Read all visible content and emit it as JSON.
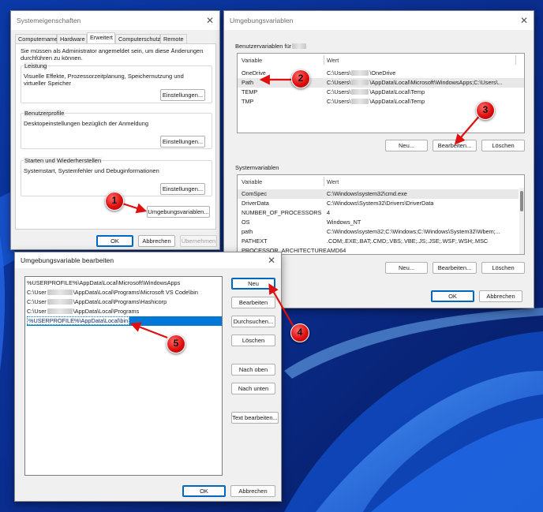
{
  "sysprops": {
    "title": "Systemeigenschaften",
    "tabs": [
      "Computername",
      "Hardware",
      "Erweitert",
      "Computerschutz",
      "Remote"
    ],
    "admin_note": "Sie müssen als Administrator angemeldet sein, um diese Änderungen durchführen zu können.",
    "perf_label": "Leistung",
    "perf_desc": "Visuelle Effekte, Prozessorzeitplanung, Speichernutzung und virtueller Speicher",
    "profiles_label": "Benutzerprofile",
    "profiles_desc": "Desktopeinstellungen bezüglich der Anmeldung",
    "startup_label": "Starten und Wiederherstellen",
    "startup_desc": "Systemstart, Systemfehler und Debuginformationen",
    "settings_btn": "Einstellungen...",
    "envvars_btn": "Umgebungsvariablen...",
    "ok": "OK",
    "cancel": "Abbrechen",
    "apply": "Übernehmen"
  },
  "envvars": {
    "title": "Umgebungsvariablen",
    "user_group_label": "Benutzervariablen für",
    "col_variable": "Variable",
    "col_value": "Wert",
    "user_vars": [
      {
        "name": "OneDrive",
        "pre": "C:\\Users\\",
        "post": "\\OneDrive"
      },
      {
        "name": "Path",
        "pre": "C:\\Users\\",
        "post": "\\AppData\\Local\\Microsoft\\WindowsApps;C:\\Users\\..."
      },
      {
        "name": "TEMP",
        "pre": "C:\\Users\\",
        "post": "\\AppData\\Local\\Temp"
      },
      {
        "name": "TMP",
        "pre": "C:\\Users\\",
        "post": "\\AppData\\Local\\Temp"
      }
    ],
    "system_group_label": "Systemvariablen",
    "system_vars": [
      {
        "name": "ComSpec",
        "value": "C:\\Windows\\system32\\cmd.exe"
      },
      {
        "name": "DriverData",
        "value": "C:\\Windows\\System32\\Drivers\\DriverData"
      },
      {
        "name": "NUMBER_OF_PROCESSORS",
        "value": "4"
      },
      {
        "name": "OS",
        "value": "Windows_NT"
      },
      {
        "name": "path",
        "value": "C:\\Windows\\system32;C:\\Windows;C:\\Windows\\System32\\Wbem;..."
      },
      {
        "name": "PATHEXT",
        "value": ".COM;.EXE;.BAT;.CMD;.VBS;.VBE;.JS;.JSE;.WSF;.WSH;.MSC"
      },
      {
        "name": "PROCESSOR_ARCHITECTURE",
        "value": "AMD64"
      }
    ],
    "new_btn": "Neu...",
    "edit_btn": "Bearbeiten...",
    "delete_btn": "Löschen",
    "ok": "OK",
    "cancel": "Abbrechen"
  },
  "editdlg": {
    "title": "Umgebungsvariable bearbeiten",
    "entries": [
      {
        "pre": "%USERPROFILE%\\AppData\\Local\\Microsoft\\WindowsApps",
        "post": ""
      },
      {
        "pre": "C:\\User",
        "post": "\\AppData\\Local\\Programs\\Microsoft VS Code\\bin"
      },
      {
        "pre": "C:\\User",
        "post": "\\AppData\\Local\\Programs\\Hashicorp"
      },
      {
        "pre": "C:\\User",
        "post": "\\AppData\\Local\\Programs"
      },
      {
        "pre": "%USERPROFILE%\\AppData\\Local\\bin",
        "post": ""
      }
    ],
    "selected_index": 4,
    "new_btn": "Neu",
    "edit_btn": "Bearbeiten",
    "browse_btn": "Durchsuchen...",
    "delete_btn": "Löschen",
    "up_btn": "Nach oben",
    "down_btn": "Nach unten",
    "edit_text_btn": "Text bearbeiten...",
    "ok": "OK",
    "cancel": "Abbrechen"
  },
  "markers": [
    "1",
    "2",
    "3",
    "4",
    "5"
  ],
  "colors": {
    "marker": "#e01010",
    "selection": "#0078d7",
    "wallpaper": "#0a2a8a"
  }
}
